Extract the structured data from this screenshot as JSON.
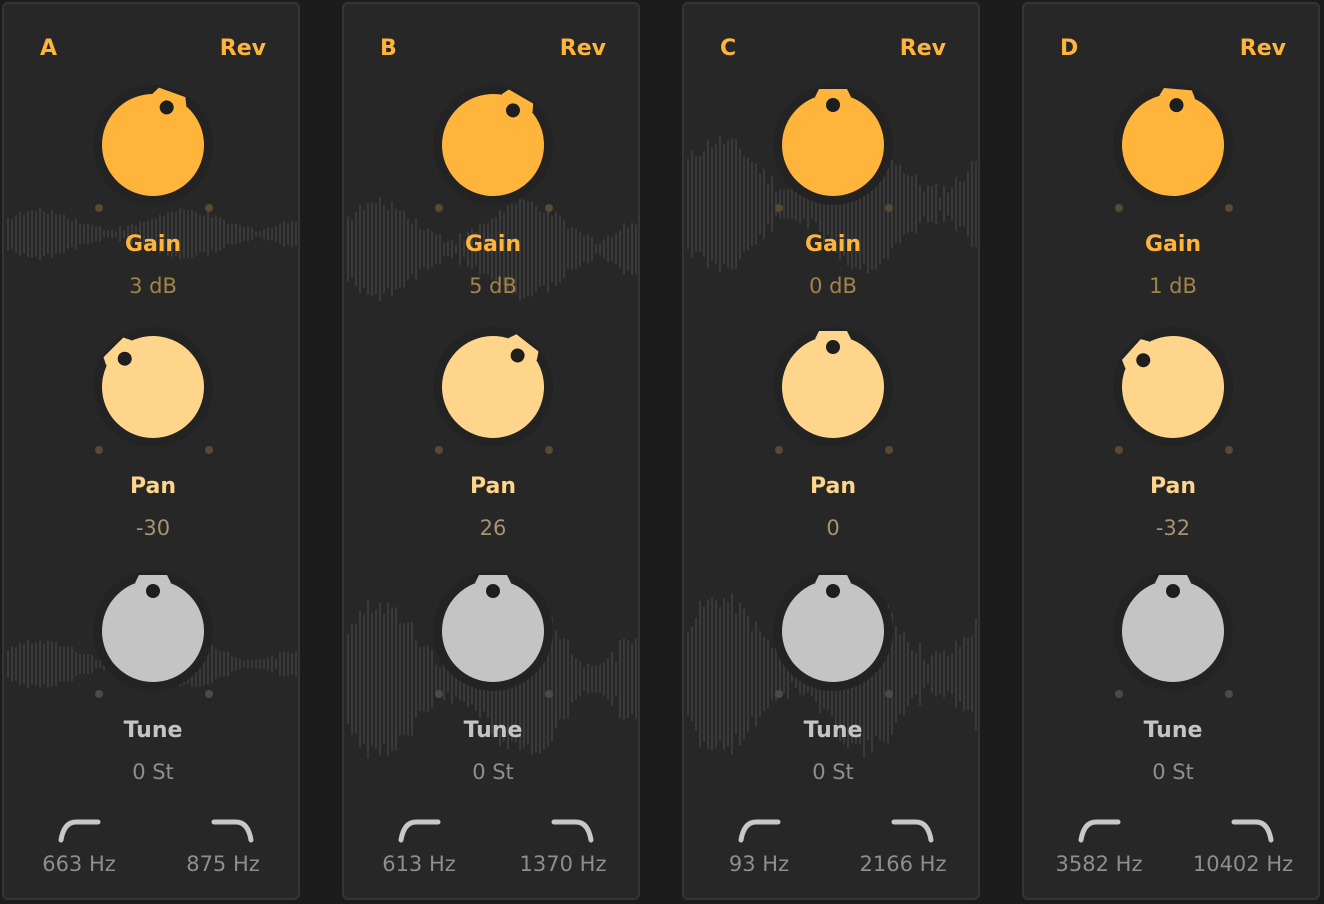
{
  "colors": {
    "gain": "#ffb43c",
    "pan": "#ffd58c",
    "tune": "#c4c4c4",
    "panel": "#272727",
    "background": "#1c1c1c"
  },
  "labels": {
    "gain": "Gain",
    "pan": "Pan",
    "tune": "Tune"
  },
  "channels": [
    {
      "name": "A",
      "rev": "Rev",
      "gain": "3 dB",
      "gain_angle": 20,
      "pan": "-30",
      "pan_angle": -45,
      "tune": "0 St",
      "tune_angle": 0,
      "filter_low": "663 Hz",
      "filter_high": "875 Hz",
      "waveform": "low"
    },
    {
      "name": "B",
      "rev": "Rev",
      "gain": "5 dB",
      "gain_angle": 30,
      "pan": "26",
      "pan_angle": 38,
      "tune": "0 St",
      "tune_angle": 0,
      "filter_low": "613 Hz",
      "filter_high": "1370 Hz",
      "waveform": "mid"
    },
    {
      "name": "C",
      "rev": "Rev",
      "gain": "0 dB",
      "gain_angle": 0,
      "pan": "0",
      "pan_angle": 0,
      "tune": "0 St",
      "tune_angle": 0,
      "filter_low": "93 Hz",
      "filter_high": "2166 Hz",
      "waveform": "high"
    },
    {
      "name": "D",
      "rev": "Rev",
      "gain": "1 dB",
      "gain_angle": 5,
      "pan": "-32",
      "pan_angle": -48,
      "tune": "0 St",
      "tune_angle": 0,
      "filter_low": "3582 Hz",
      "filter_high": "10402 Hz",
      "waveform": "none"
    }
  ]
}
